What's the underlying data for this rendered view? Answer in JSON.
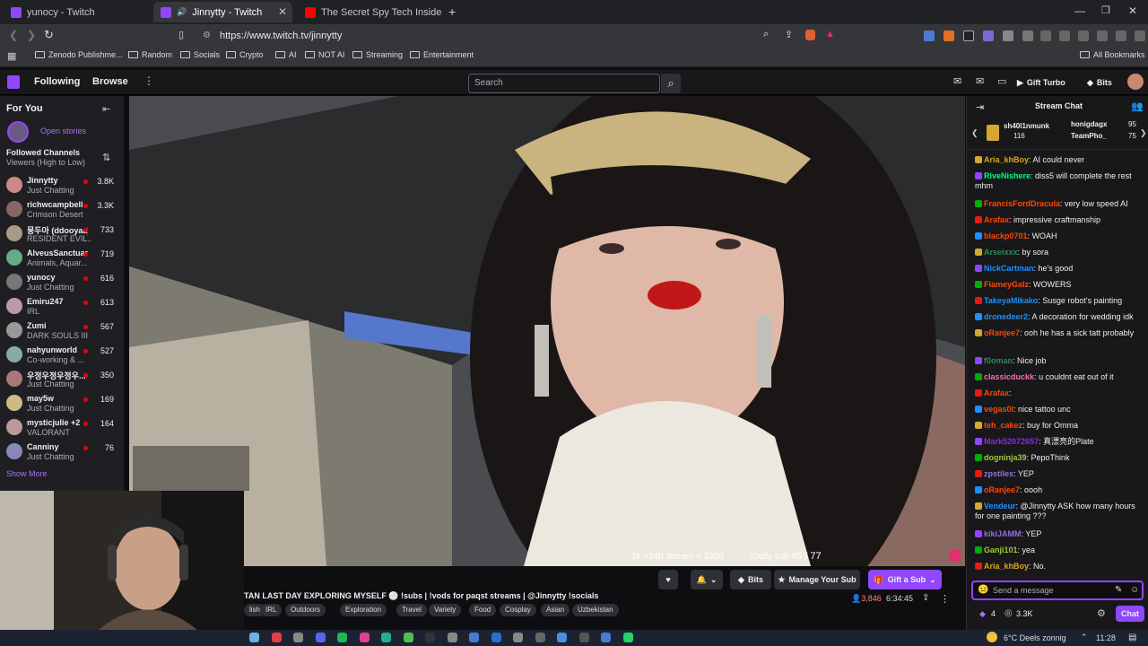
{
  "browser": {
    "tabs": [
      {
        "title": "yunocy - Twitch",
        "active": false
      },
      {
        "title": "Jinnytty - Twitch",
        "active": true
      },
      {
        "title": "The Secret Spy Tech Inside Every Cre",
        "active": false
      }
    ],
    "url": "https://www.twitch.tv/jinnytty",
    "bookmarks": [
      "Zenodo Publishme...",
      "Random",
      "Socials",
      "Crypto",
      "AI",
      "NOT AI",
      "Streaming",
      "Entertainment"
    ],
    "all_bookmarks": "All Bookmarks"
  },
  "twitch_nav": {
    "following": "Following",
    "browse": "Browse",
    "search_placeholder": "Search",
    "gift_turbo": "Gift Turbo",
    "bits": "Bits"
  },
  "sidebar": {
    "for_you": "For You",
    "open_stories": "Open stories",
    "followed_heading": "Followed Channels",
    "followed_sort": "Viewers (High to Low)",
    "show_more": "Show More",
    "channels": [
      {
        "name": "Jinnytty",
        "game": "Just Chatting",
        "viewers": "3.8K"
      },
      {
        "name": "richwcampbell",
        "game": "Crimson Desert",
        "viewers": "3.3K"
      },
      {
        "name": "뭉두아 (ddooyaa)",
        "game": "RESIDENT EVIL...",
        "viewers": "733"
      },
      {
        "name": "AlveusSanctuary",
        "game": "Animals, Aquar...",
        "viewers": "719"
      },
      {
        "name": "yunocy",
        "game": "Just Chatting",
        "viewers": "616"
      },
      {
        "name": "Emiru247",
        "game": "IRL",
        "viewers": "613"
      },
      {
        "name": "Zumi",
        "game": "DARK SOULS III",
        "viewers": "567"
      },
      {
        "name": "nahyunworld",
        "game": "Co-working & ...",
        "viewers": "527"
      },
      {
        "name": "우정우정우정우...",
        "game": "Just Chatting",
        "viewers": "350"
      },
      {
        "name": "may5w",
        "game": "Just Chatting",
        "viewers": "169"
      },
      {
        "name": "mysticjulie +2",
        "game": "VALORANT",
        "viewers": "164"
      },
      {
        "name": "Canniny",
        "game": "Just Chatting",
        "viewers": "76"
      }
    ]
  },
  "video": {
    "overlay_left": "1k =24h stream = 3208",
    "overlay_right": "!Daily sub",
    "sub_goal": "45 / 77"
  },
  "stream_info": {
    "title": "TAN LAST DAY EXPLORING MYSELF ⚪ !subs | !vods for paqst streams | @Jinnytty !socials",
    "tags": [
      "lish",
      "IRL",
      "Outdoors",
      "Exploration",
      "Travel",
      "Variety",
      "Food",
      "Cosplay",
      "Asian",
      "Uzbekistan"
    ],
    "viewers": "3,846",
    "uptime": "6:34:45",
    "bits_label": "Bits",
    "manage_sub": "Manage Your Sub",
    "gift_sub": "Gift a Sub"
  },
  "chat": {
    "header": "Stream Chat",
    "gifters": [
      {
        "name": "sh40l1nmunk",
        "count": "116"
      },
      {
        "name": "honigdagx",
        "count": "95"
      },
      {
        "name": "TeamPho_",
        "count": "75"
      }
    ],
    "messages": [
      {
        "user": "Aria_khBoy",
        "text": "AI could never",
        "color": "#daa520"
      },
      {
        "user": "RiveNishere",
        "text": "diss5 will complete the rest mhm",
        "color": "#00ff7f"
      },
      {
        "user": "FrancisFordDracula",
        "text": "very low speed AI",
        "color": "#ff4500"
      },
      {
        "user": "Arafax",
        "text": "impressive craftmanship",
        "color": "#ff4500"
      },
      {
        "user": "blackp0701",
        "text": "WOAH",
        "color": "#ff4500"
      },
      {
        "user": "Arseixxx",
        "text": "by sora",
        "color": "#2e8b57"
      },
      {
        "user": "NickCartman",
        "text": "he's good",
        "color": "#1e90ff"
      },
      {
        "user": "FlameyGalz",
        "text": "WOWERS",
        "color": "#ff4500"
      },
      {
        "user": "TakeyaMikako",
        "text": "Susge robot's painting",
        "color": "#1e90ff"
      },
      {
        "user": "dronedeer2",
        "text": "A decoration for wedding idk",
        "color": "#1e90ff"
      },
      {
        "user": "oRanjee7",
        "text": "ooh he has a sick tatt probably",
        "color": "#ff4500"
      },
      {
        "user": "f0oman",
        "text": "Nice job",
        "color": "#2e8b57"
      },
      {
        "user": "classicduckk",
        "text": "u couldnt eat out of it",
        "color": "#ff69b4"
      },
      {
        "user": "Arafax",
        "text": "",
        "color": "#ff4500"
      },
      {
        "user": "vegas0l",
        "text": "nice tattoo unc",
        "color": "#ff4500"
      },
      {
        "user": "teh_cakez",
        "text": "buy for Omma",
        "color": "#ff4500"
      },
      {
        "user": "Mark52072657",
        "text": "真漂亮的Plate",
        "color": "#8a2be2"
      },
      {
        "user": "dogninja39",
        "text": "PepoThink",
        "color": "#9acd32"
      },
      {
        "user": "zpstiles",
        "text": "YEP",
        "color": "#9370db"
      },
      {
        "user": "oRanjee7",
        "text": "oooh",
        "color": "#ff4500"
      },
      {
        "user": "Vendeur",
        "text": "@Jinnytty ASK how many hours for one painting ???",
        "color": "#1e90ff"
      },
      {
        "user": "kikiJAMM",
        "text": "YEP",
        "color": "#9370db"
      },
      {
        "user": "Ganji101",
        "text": "yea",
        "color": "#9acd32"
      },
      {
        "user": "Aria_khBoy",
        "text": "No.",
        "color": "#daa520"
      }
    ],
    "input_placeholder": "Send a message",
    "points": "4",
    "channel_points": "3.3K",
    "chat_button": "Chat"
  },
  "taskbar": {
    "weather": "6°C Deels zonnig",
    "time": "11:28"
  }
}
